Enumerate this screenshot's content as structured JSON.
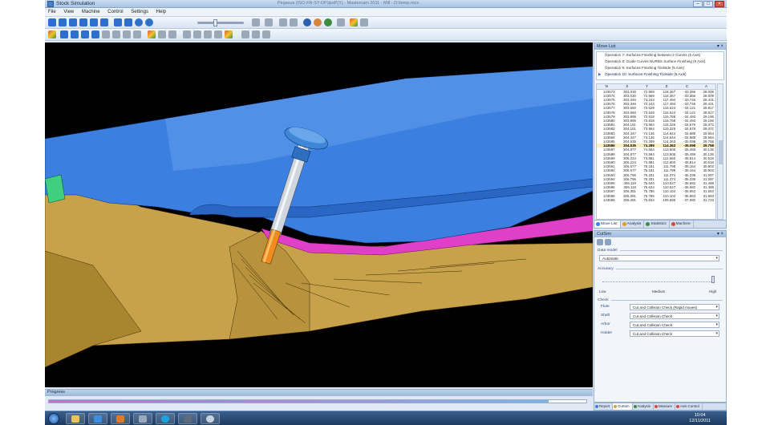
{
  "window": {
    "title": "Stock Simulation",
    "document": "Pegasus (ISO-FR-SY-OP)ipsP(Y) - Mastercam 2011 - Mill - D:\\temp.mcx"
  },
  "menu": [
    "File",
    "View",
    "Machine",
    "Control",
    "Settings",
    "Help"
  ],
  "viewport_colors": {
    "stock_blue": "#3b7fe0",
    "stock_tan": "#c8a24a",
    "fixture_magenta": "#e040c8",
    "tool_holder": "#3e86d6",
    "tool_flute": "#f08c1e",
    "background": "#000000"
  },
  "progress": {
    "title": "Progress",
    "fraction": 0.93
  },
  "move_list": {
    "title": "Move List",
    "operations": [
      "Operation 7: Surfaces Finishing between 2 Curves (5 Axis)",
      "Operation 8: Guide Curves NURBS Surface Finishing (5 Axis)",
      "Operation 9: Surfaces Finishing Toolside (5 Axis)",
      "Operation 10: Surfaces Finishing Toolside (5 Axis)"
    ],
    "columns": [
      "N",
      "X",
      "Y",
      "Z",
      "C",
      "A"
    ],
    "rows": [
      [
        "143573",
        "303.030",
        "72.959",
        "118.367",
        "-33.366",
        "28.009"
      ],
      [
        "143574",
        "303.030",
        "72.959",
        "118.367",
        "-33.366",
        "28.009"
      ],
      [
        "143575",
        "303.346",
        "73.243",
        "117.494",
        "-33.746",
        "28.431"
      ],
      [
        "143576",
        "303.346",
        "73.243",
        "117.494",
        "-33.746",
        "28.431"
      ],
      [
        "143577",
        "303.660",
        "73.529",
        "116.624",
        "-34.121",
        "28.817"
      ],
      [
        "143578",
        "303.660",
        "73.529",
        "116.624",
        "-34.121",
        "28.817"
      ],
      [
        "143579",
        "303.995",
        "73.818",
        "115.758",
        "-34.493",
        "29.196"
      ],
      [
        "143580",
        "303.995",
        "73.818",
        "115.758",
        "-34.493",
        "29.196"
      ],
      [
        "143581",
        "304.161",
        "73.964",
        "115.325",
        "-34.676",
        "29.372"
      ],
      [
        "143582",
        "304.161",
        "73.964",
        "115.325",
        "-34.676",
        "29.372"
      ],
      [
        "143583",
        "304.347",
        "74.136",
        "114.844",
        "-34.888",
        "29.564"
      ],
      [
        "143584",
        "304.347",
        "74.136",
        "114.844",
        "-34.888",
        "29.564"
      ],
      [
        "143585",
        "304.535",
        "74.289",
        "114.363",
        "-35.098",
        "29.758"
      ],
      [
        "143586",
        "304.535",
        "74.289",
        "114.363",
        "-35.098",
        "29.758"
      ],
      [
        "143587",
        "304.877",
        "74.584",
        "113.505",
        "-35.459",
        "30.136"
      ],
      [
        "143588",
        "304.877",
        "74.584",
        "113.505",
        "-35.459",
        "30.136"
      ],
      [
        "143589",
        "305.224",
        "74.881",
        "112.650",
        "-35.814",
        "30.518"
      ],
      [
        "143590",
        "305.224",
        "74.881",
        "112.650",
        "-35.814",
        "30.518"
      ],
      [
        "143591",
        "305.577",
        "75.181",
        "111.798",
        "-36.164",
        "30.903"
      ],
      [
        "143592",
        "305.577",
        "75.181",
        "111.798",
        "-36.164",
        "30.903"
      ],
      [
        "143593",
        "305.796",
        "75.331",
        "111.374",
        "-36.339",
        "31.097"
      ],
      [
        "143594",
        "305.796",
        "75.331",
        "111.374",
        "-36.339",
        "31.097"
      ],
      [
        "143595",
        "306.118",
        "75.634",
        "110.527",
        "-36.682",
        "31.488"
      ],
      [
        "143596",
        "306.118",
        "75.634",
        "110.527",
        "-36.682",
        "31.488"
      ],
      [
        "143597",
        "306.381",
        "75.786",
        "110.104",
        "-36.853",
        "31.683"
      ],
      [
        "143598",
        "306.381",
        "75.786",
        "110.104",
        "-36.853",
        "31.683"
      ],
      [
        "143599",
        "306.481",
        "75.934",
        "109.685",
        "-37.080",
        "31.733"
      ]
    ],
    "highlight_n": "143586",
    "tabs": [
      "Move List",
      "Analysis",
      "Statistics",
      "Machine"
    ]
  },
  "cutsim": {
    "title": "CutSim",
    "data_model_label": "Data model",
    "data_model_value": "Automatic",
    "accuracy_label": "Accuracy",
    "accuracy_low": "Low",
    "accuracy_medium": "Medium",
    "accuracy_high": "High",
    "accuracy_level": 1.0,
    "check_label": "Check",
    "checks": [
      {
        "label": "Flute",
        "value": "Cut and Collision Check (Rapid moves)"
      },
      {
        "label": "Shaft",
        "value": "Cut and Collision Check"
      },
      {
        "label": "Arbor",
        "value": "Cut and Collision Check"
      },
      {
        "label": "Holder",
        "value": "Cut and Collision Check"
      }
    ]
  },
  "bottom_tabs": [
    "Report",
    "CutSim",
    "Analysis",
    "Measure",
    "Axis Control"
  ],
  "taskbar": {
    "time": "10:04",
    "date": "12/11/2011"
  }
}
